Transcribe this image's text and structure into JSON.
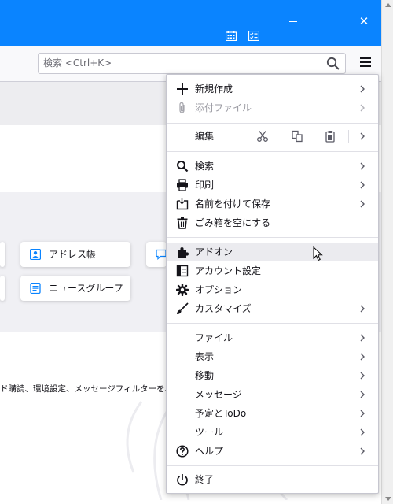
{
  "window": {
    "accent": "#0a84ff",
    "controls": [
      "minimize-icon",
      "maximize-icon",
      "close-icon"
    ],
    "titlebar_icons": [
      "calendar-icon",
      "tasks-icon"
    ],
    "close_glyph": "✕"
  },
  "toolbar": {
    "search_placeholder": "検索 <Ctrl+K>",
    "search_icon": "search-icon",
    "menu_icon": "hamburger-icon"
  },
  "content": {
    "cards": [
      {
        "label": "アドレス帳",
        "icon": "address-book-icon"
      },
      {
        "label": "ニュースグループ",
        "icon": "newsgroup-icon"
      }
    ],
    "description": "ド購読、環境設定、メッセージフィルターを、一括"
  },
  "menu": {
    "groups": [
      [
        {
          "label": "新規作成",
          "icon": "plus-icon",
          "submenu": true
        },
        {
          "label": "添付ファイル",
          "icon": "paperclip-icon",
          "submenu": true,
          "disabled": true
        }
      ],
      [
        {
          "label": "編集",
          "submenu": true,
          "actions": [
            "cut-icon",
            "copy-icon",
            "paste-icon"
          ]
        }
      ],
      [
        {
          "label": "検索",
          "icon": "search-icon",
          "submenu": true
        },
        {
          "label": "印刷",
          "icon": "printer-icon",
          "submenu": true
        },
        {
          "label": "名前を付けて保存",
          "icon": "save-icon",
          "submenu": true
        },
        {
          "label": "ごみ箱を空にする",
          "icon": "trash-icon"
        }
      ],
      [
        {
          "label": "アドオン",
          "icon": "puzzle-icon",
          "hover": true
        },
        {
          "label": "アカウント設定",
          "icon": "account-settings-icon"
        },
        {
          "label": "オプション",
          "icon": "gear-icon"
        },
        {
          "label": "カスタマイズ",
          "icon": "brush-icon",
          "submenu": true
        }
      ],
      [
        {
          "label": "ファイル",
          "submenu": true
        },
        {
          "label": "表示",
          "submenu": true
        },
        {
          "label": "移動",
          "submenu": true
        },
        {
          "label": "メッセージ",
          "submenu": true
        },
        {
          "label": "予定とToDo",
          "submenu": true
        },
        {
          "label": "ツール",
          "submenu": true
        },
        {
          "label": "ヘルプ",
          "icon": "help-icon",
          "submenu": true
        }
      ],
      [
        {
          "label": "終了",
          "icon": "power-icon"
        }
      ]
    ]
  }
}
